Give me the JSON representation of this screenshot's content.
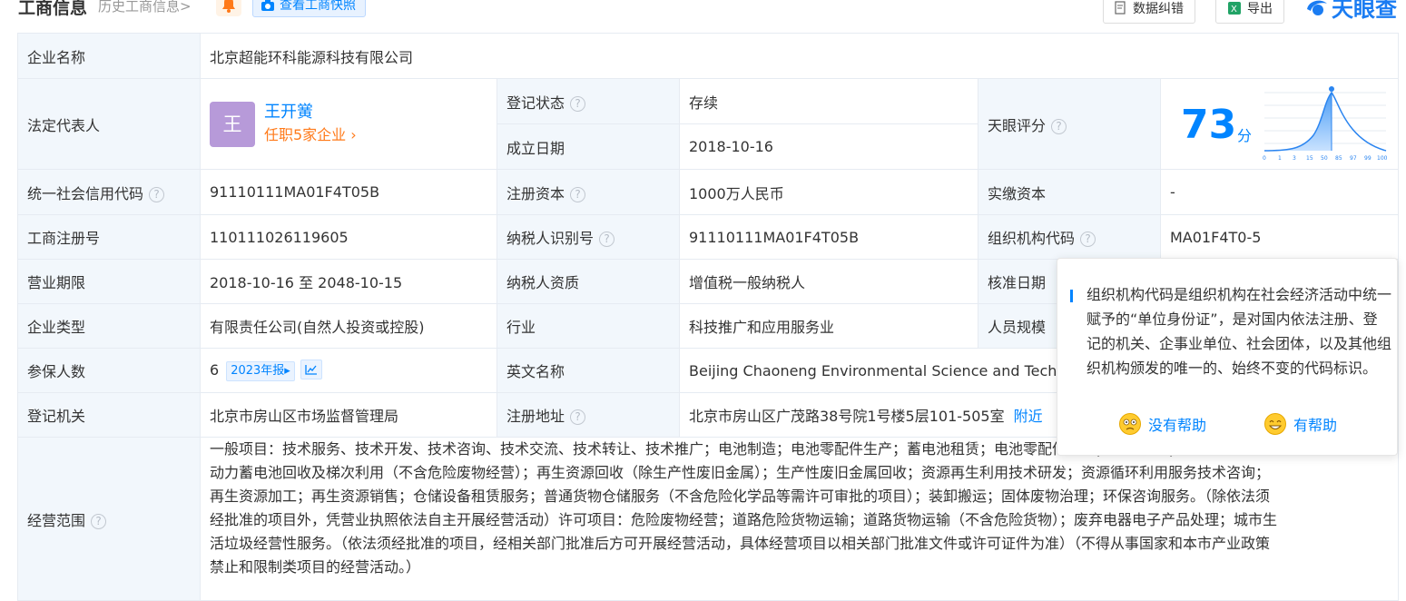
{
  "header": {
    "title": "工商信息",
    "history": "历史工商信息>",
    "snapshot_label": "查看工商快照",
    "correction_label": "数据纠错",
    "export_label": "导出",
    "logo_text": "天眼查"
  },
  "rows": {
    "company_name_label": "企业名称",
    "company_name": "北京超能环科能源科技有限公司",
    "legal_rep_label": "法定代表人",
    "legal_rep_avatar": "王",
    "legal_rep_name": "王开黉",
    "legal_rep_positions": "任职5家企业",
    "reg_status_label": "登记状态",
    "reg_status": "存续",
    "founded_label": "成立日期",
    "founded": "2018-10-16",
    "score_label": "天眼评分",
    "score": "73",
    "score_unit": "分",
    "score_ticks": [
      "0",
      "1",
      "3",
      "15",
      "50",
      "85",
      "97",
      "99",
      "100"
    ],
    "credit_code_label": "统一社会信用代码",
    "credit_code": "91110111MA01F4T05B",
    "reg_capital_label": "注册资本",
    "reg_capital": "1000万人民币",
    "paid_capital_label": "实缴资本",
    "paid_capital": "-",
    "biz_reg_no_label": "工商注册号",
    "biz_reg_no": "110111026119605",
    "taxpayer_id_label": "纳税人识别号",
    "taxpayer_id": "91110111MA01F4T05B",
    "org_code_label": "组织机构代码",
    "org_code": "MA01F4T0-5",
    "term_label": "营业期限",
    "term": "2018-10-16 至 2048-10-15",
    "taxpayer_qual_label": "纳税人资质",
    "taxpayer_qual": "增值税一般纳税人",
    "approval_date_label": "核准日期",
    "company_type_label": "企业类型",
    "company_type": "有限责任公司(自然人投资或控股)",
    "industry_label": "行业",
    "industry": "科技推广和应用服务业",
    "staff_size_label": "人员规模",
    "insured_label": "参保人数",
    "insured": "6",
    "insured_report": "2023年报",
    "english_name_label": "英文名称",
    "english_name": "Beijing Chaoneng Environmental Science and Techr",
    "reg_authority_label": "登记机关",
    "reg_authority": "北京市房山区市场监督管理局",
    "reg_address_label": "注册地址",
    "reg_address": "北京市房山区广茂路38号院1号楼5层101-505室",
    "nearby": "附近",
    "scope_label": "经营范围",
    "scope": "一般项目：技术服务、技术开发、技术咨询、技术交流、技术转让、技术推广；电池制造；电池零配件生产；蓄电池租赁；电池零配件销售；电池销售；新能源汽车废旧\n动力蓄电池回收及梯次利用（不含危险废物经营）；再生资源回收（除生产性废旧金属）；生产性废旧金属回收；资源再生利用技术研发；资源循环利用服务技术咨询；\n再生资源加工；再生资源销售；仓储设备租赁服务；普通货物仓储服务（不含危险化学品等需许可审批的项目）；装卸搬运；固体废物治理；环保咨询服务。（除依法须\n经批准的项目外，凭营业执照依法自主开展经营活动）许可项目：危险废物经营；道路危险货物运输；道路货物运输（不含危险货物）；废弃电器电子产品处理；城市生\n活垃圾经营性服务。（依法须经批准的项目，经相关部门批准后方可开展经营活动，具体经营项目以相关部门批准文件或许可证件为准）（不得从事国家和本市产业政策\n禁止和限制类项目的经营活动。）"
  },
  "tooltip": {
    "text": "组织机构代码是组织机构在社会经济活动中统一赋予的“单位身份证”，是对国内依法注册、登记的机关、企事业单位、社会团体，以及其他组织机构颁发的唯一的、始终不变的代码标识。",
    "not_helpful": "没有帮助",
    "helpful": "有帮助"
  },
  "colors": {
    "accent": "#0084ff",
    "label_bg": "#f2f7fc",
    "status_green": "#21a16b",
    "orange": "#ff7a1a"
  }
}
